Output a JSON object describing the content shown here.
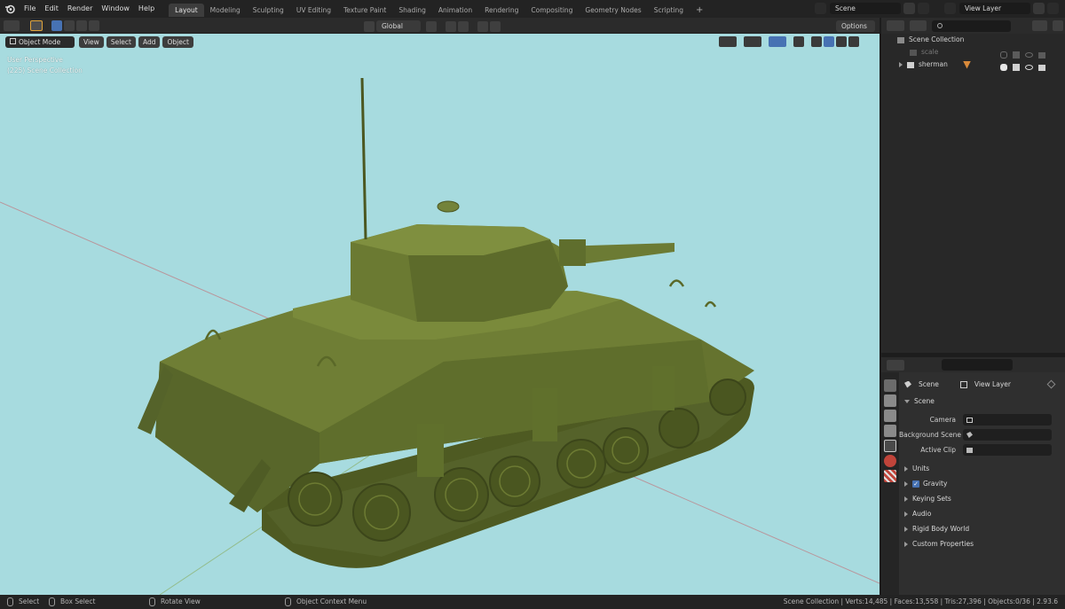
{
  "menu": [
    "File",
    "Edit",
    "Render",
    "Window",
    "Help"
  ],
  "workspaces": [
    "Layout",
    "Modeling",
    "Sculpting",
    "UV Editing",
    "Texture Paint",
    "Shading",
    "Animation",
    "Rendering",
    "Compositing",
    "Geometry Nodes",
    "Scripting"
  ],
  "active_workspace": "Layout",
  "add_tab": "+",
  "scene_name": "Scene",
  "view_layer": "View Layer",
  "header": {
    "mode": "Object Mode",
    "view": "View",
    "select": "Select",
    "add": "Add",
    "object": "Object",
    "transform_orientation": "Global",
    "options": "Options"
  },
  "viewport": {
    "perspective": "User Perspective",
    "collection": "(225) Scene Collection",
    "background": "#a7dbdf",
    "model_color": "#5b6b2a"
  },
  "outliner": {
    "root": "Scene Collection",
    "items": [
      {
        "name": "scale"
      },
      {
        "name": "sherman"
      }
    ]
  },
  "properties": {
    "breadcrumb_scene": "Scene",
    "breadcrumb_viewlayer": "View Layer",
    "section": "Scene",
    "camera_label": "Camera",
    "bg_scene_label": "Background Scene",
    "active_clip_label": "Active Clip",
    "panels": [
      "Units",
      "Gravity",
      "Keying Sets",
      "Audio",
      "Rigid Body World",
      "Custom Properties"
    ],
    "gravity_checked": true
  },
  "status": {
    "select": "Select",
    "box_select": "Box Select",
    "rotate": "Rotate View",
    "context": "Object Context Menu",
    "stats": "Scene Collection | Verts:14,485 | Faces:13,558 | Tris:27,396 | Objects:0/36 | 2.93.6"
  }
}
